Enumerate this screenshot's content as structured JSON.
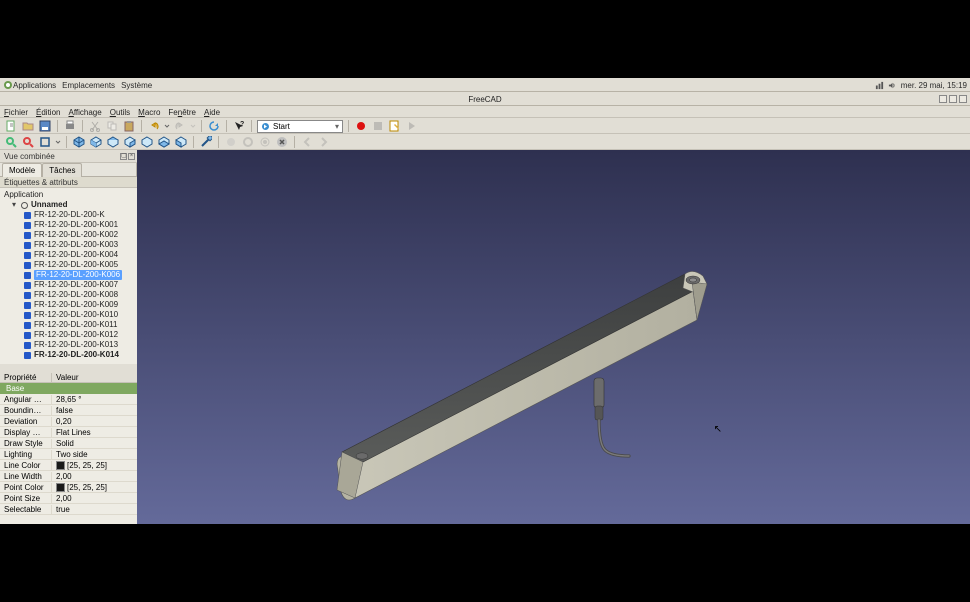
{
  "osbar": {
    "apps": "Applications",
    "places": "Emplacements",
    "system": "Système",
    "date": "mer. 29 mai, 15:19"
  },
  "window": {
    "title": "FreeCAD"
  },
  "menu": {
    "file": "Fichier",
    "edit": "Édition",
    "view": "Affichage",
    "tools": "Outils",
    "macro": "Macro",
    "windows": "Fenêtre",
    "help": "Aide"
  },
  "toolbar": {
    "workbench": "Start"
  },
  "panel": {
    "title": "Vue combinée",
    "tabs": {
      "model": "Modèle",
      "tasks": "Tâches"
    },
    "labels": "Étiquettes & attributs",
    "apptxt": "Application"
  },
  "tree": {
    "root": "Unnamed",
    "items": [
      "FR-12-20-DL-200-K",
      "FR-12-20-DL-200-K001",
      "FR-12-20-DL-200-K002",
      "FR-12-20-DL-200-K003",
      "FR-12-20-DL-200-K004",
      "FR-12-20-DL-200-K005",
      "FR-12-20-DL-200-K006",
      "FR-12-20-DL-200-K007",
      "FR-12-20-DL-200-K008",
      "FR-12-20-DL-200-K009",
      "FR-12-20-DL-200-K010",
      "FR-12-20-DL-200-K011",
      "FR-12-20-DL-200-K012",
      "FR-12-20-DL-200-K013",
      "FR-12-20-DL-200-K014"
    ],
    "selectedIndex": 6,
    "boldLast": true
  },
  "props": {
    "col1": "Propriété",
    "col2": "Valeur",
    "group": "Base",
    "rows": [
      {
        "k": "Angular …",
        "v": "28,65 °"
      },
      {
        "k": "Boundin…",
        "v": "false"
      },
      {
        "k": "Deviation",
        "v": "0,20"
      },
      {
        "k": "Display …",
        "v": "Flat Lines"
      },
      {
        "k": "Draw Style",
        "v": "Solid"
      },
      {
        "k": "Lighting",
        "v": "Two side"
      },
      {
        "k": "Line Color",
        "v": "[25, 25, 25]",
        "color": true
      },
      {
        "k": "Line Width",
        "v": "2,00"
      },
      {
        "k": "Point Color",
        "v": "[25, 25, 25]",
        "color": true
      },
      {
        "k": "Point Size",
        "v": "2,00"
      },
      {
        "k": "Selectable",
        "v": "true"
      }
    ]
  }
}
